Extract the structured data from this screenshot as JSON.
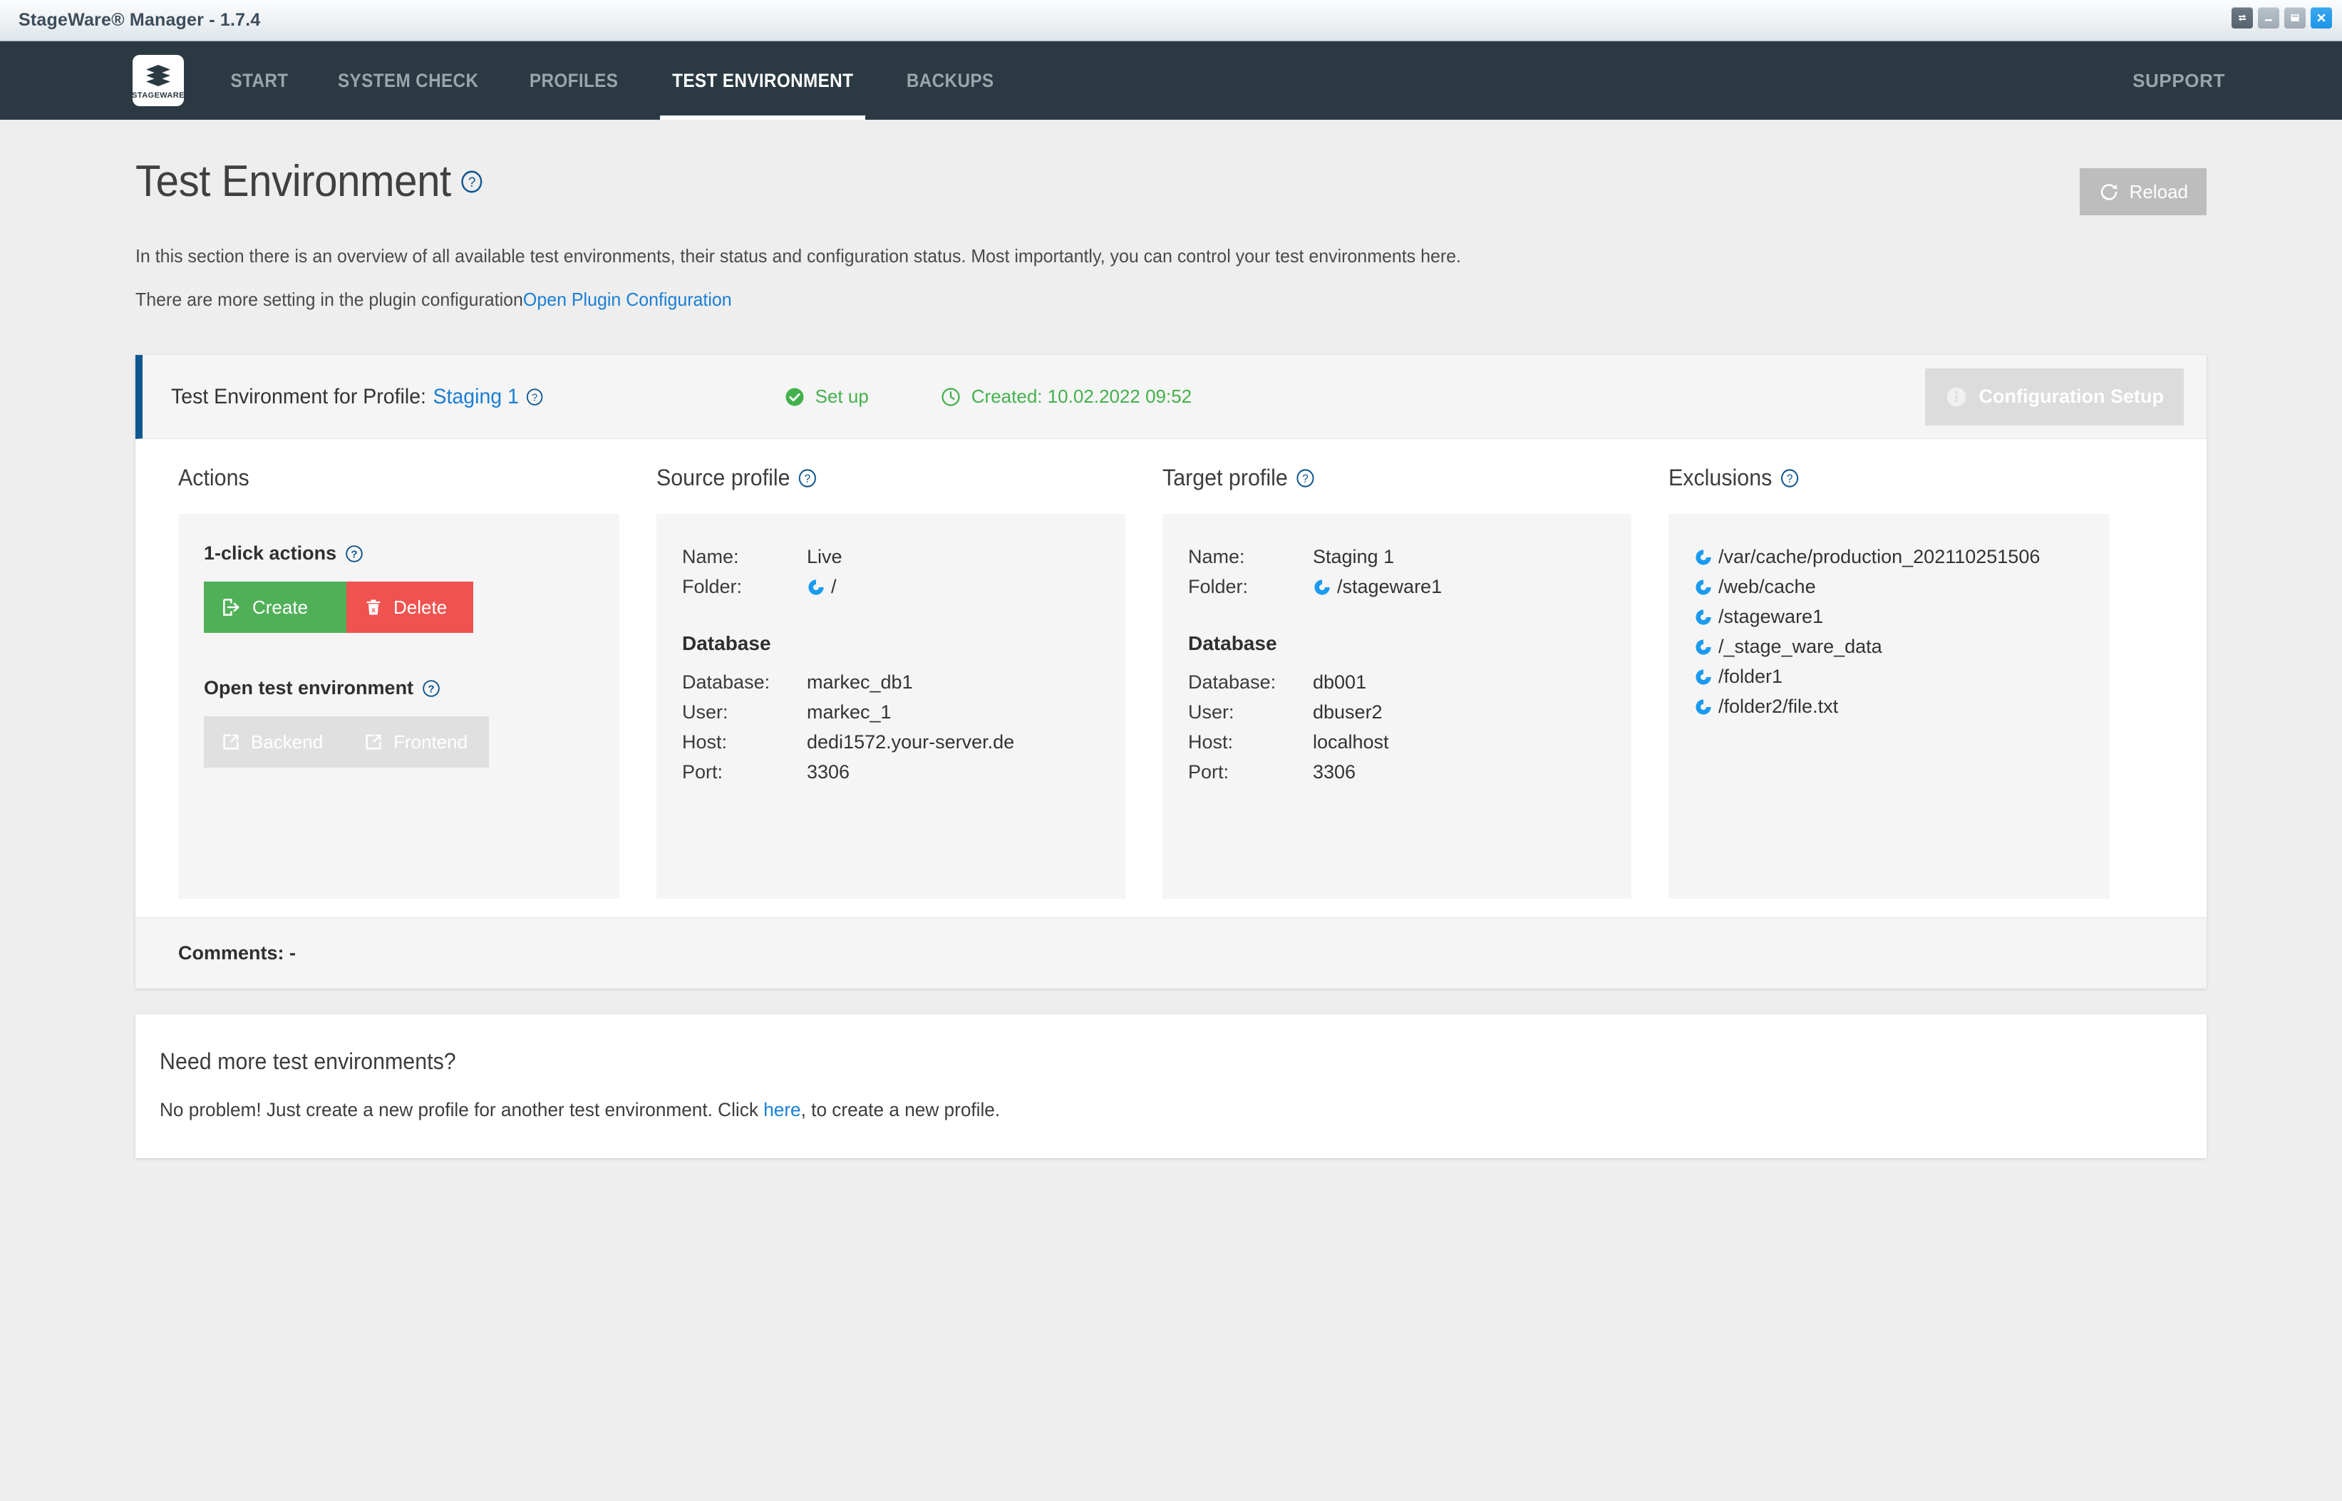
{
  "window": {
    "title": "StageWare® Manager - 1.7.4",
    "controls": [
      "restore-swap",
      "minimize",
      "maximize",
      "close"
    ]
  },
  "nav": {
    "logo_text": "STAGEWARE",
    "items": [
      {
        "label": "START",
        "active": false
      },
      {
        "label": "SYSTEM CHECK",
        "active": false
      },
      {
        "label": "PROFILES",
        "active": false
      },
      {
        "label": "TEST ENVIRONMENT",
        "active": true
      },
      {
        "label": "BACKUPS",
        "active": false
      }
    ],
    "support_label": "SUPPORT"
  },
  "page": {
    "title": "Test Environment",
    "reload_label": "Reload",
    "intro": "In this section there is an overview of all available test environments, their status and configuration status. Most importantly, you can control your test environments here.",
    "intro2_prefix": "There are more setting in the plugin configuration",
    "intro2_link": "Open Plugin Configuration"
  },
  "env_card": {
    "title_prefix": "Test Environment for Profile:",
    "profile_name": "Staging 1",
    "status_setup": "Set up",
    "status_created": "Created: 10.02.2022 09:52",
    "config_setup_label": "Configuration Setup",
    "comments_label": "Comments: -"
  },
  "actions": {
    "heading": "Actions",
    "one_click_heading": "1-click actions",
    "create_label": "Create",
    "delete_label": "Delete",
    "open_heading": "Open test environment",
    "backend_label": "Backend",
    "frontend_label": "Frontend"
  },
  "source_profile": {
    "heading": "Source profile",
    "name_label": "Name:",
    "name_value": "Live",
    "folder_label": "Folder:",
    "folder_value": "/",
    "database_heading": "Database",
    "database_label": "Database:",
    "database_value": "markec_db1",
    "user_label": "User:",
    "user_value": "markec_1",
    "host_label": "Host:",
    "host_value": "dedi1572.your-server.de",
    "port_label": "Port:",
    "port_value": "3306"
  },
  "target_profile": {
    "heading": "Target profile",
    "name_label": "Name:",
    "name_value": "Staging 1",
    "folder_label": "Folder:",
    "folder_value": "/stageware1",
    "database_heading": "Database",
    "database_label": "Database:",
    "database_value": "db001",
    "user_label": "User:",
    "user_value": "dbuser2",
    "host_label": "Host:",
    "host_value": "localhost",
    "port_label": "Port:",
    "port_value": "3306"
  },
  "exclusions": {
    "heading": "Exclusions",
    "items": [
      "/var/cache/production_202110251506",
      "/web/cache",
      "/stageware1",
      "/_stage_ware_data",
      "/folder1",
      "/folder2/file.txt"
    ]
  },
  "more": {
    "title": "Need more test environments?",
    "text_prefix": "No problem! Just create a new profile for another test environment. Click ",
    "link": "here",
    "text_suffix": ", to create a new profile."
  },
  "colors": {
    "nav_bg": "#2b3a42",
    "accent_blue": "#10568f",
    "link_blue": "#1a7fd4",
    "success_green": "#43b14b",
    "create_green": "#50b058",
    "delete_red": "#ef5350",
    "icon_blue": "#1a9bf0",
    "page_bg": "#eeeeee"
  }
}
